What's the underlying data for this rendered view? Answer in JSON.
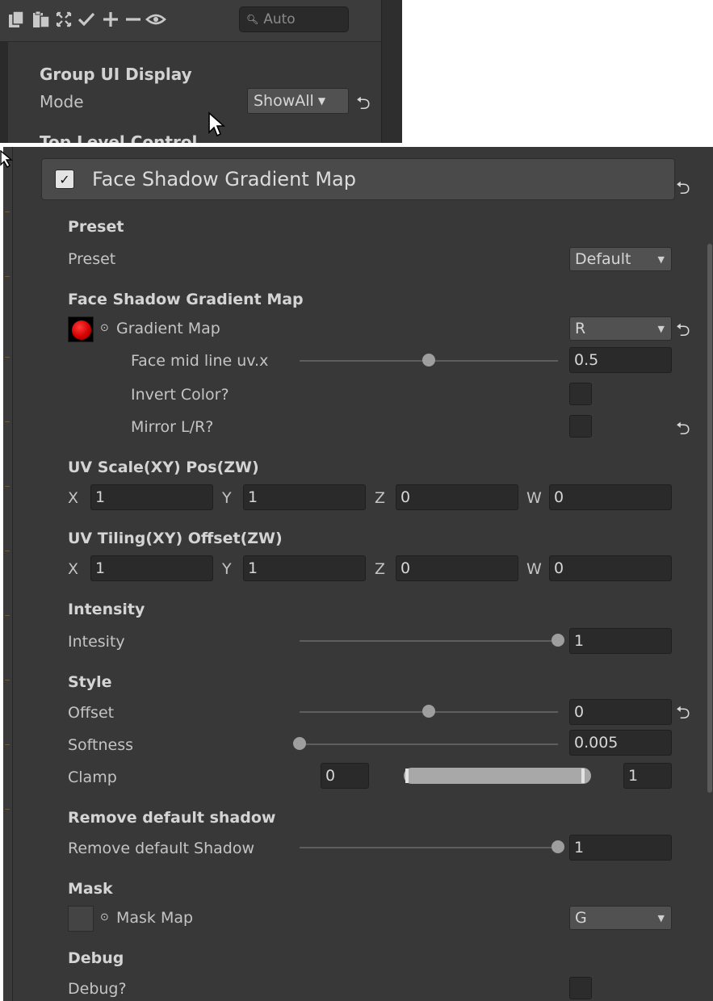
{
  "toolbar": {
    "search_placeholder": "Auto",
    "icons": [
      "copy-icon",
      "paste-icon",
      "expand-all-icon",
      "check-icon",
      "plus-icon",
      "minus-icon",
      "eye-icon"
    ]
  },
  "group_ui": {
    "title": "Group UI Display",
    "mode_label": "Mode",
    "mode_value": "ShowAll",
    "cut_text": "Top Level Control"
  },
  "panel": {
    "header_title": "Face Shadow Gradient Map",
    "preset": {
      "section": "Preset",
      "label": "Preset",
      "value": "Default"
    },
    "gradient": {
      "section": "Face Shadow Gradient Map",
      "map_label": "Gradient Map",
      "channel": "R",
      "midline_label": "Face mid line uv.x",
      "midline_value": "0.5",
      "midline_fraction": 0.5,
      "invert_label": "Invert Color?",
      "mirror_label": "Mirror L/R?"
    },
    "uv_scale": {
      "section": "UV Scale(XY) Pos(ZW)",
      "x_label": "X",
      "x": "1",
      "y_label": "Y",
      "y": "1",
      "z_label": "Z",
      "z": "0",
      "w_label": "W",
      "w": "0"
    },
    "uv_tiling": {
      "section": "UV Tiling(XY) Offset(ZW)",
      "x_label": "X",
      "x": "1",
      "y_label": "Y",
      "y": "1",
      "z_label": "Z",
      "z": "0",
      "w_label": "W",
      "w": "0"
    },
    "intensity": {
      "section": "Intensity",
      "label": "Intesity",
      "value": "1",
      "fraction": 1.0
    },
    "style": {
      "section": "Style",
      "offset_label": "Offset",
      "offset_value": "0",
      "offset_fraction": 0.5,
      "softness_label": "Softness",
      "softness_value": "0.005",
      "softness_fraction": 0.0,
      "clamp_label": "Clamp",
      "clamp_min": "0",
      "clamp_max": "1"
    },
    "remove_shadow": {
      "section": "Remove default shadow",
      "label": "Remove default Shadow",
      "value": "1",
      "fraction": 1.0
    },
    "mask": {
      "section": "Mask",
      "label": "Mask Map",
      "channel": "G"
    },
    "debug": {
      "section": "Debug",
      "label": "Debug?"
    }
  },
  "colors": {
    "panel_bg": "#383838",
    "field_bg": "#2a2a2a",
    "dropdown_bg": "#515151",
    "text": "#c4c4c4",
    "gradient_thumb": "#d40000"
  }
}
